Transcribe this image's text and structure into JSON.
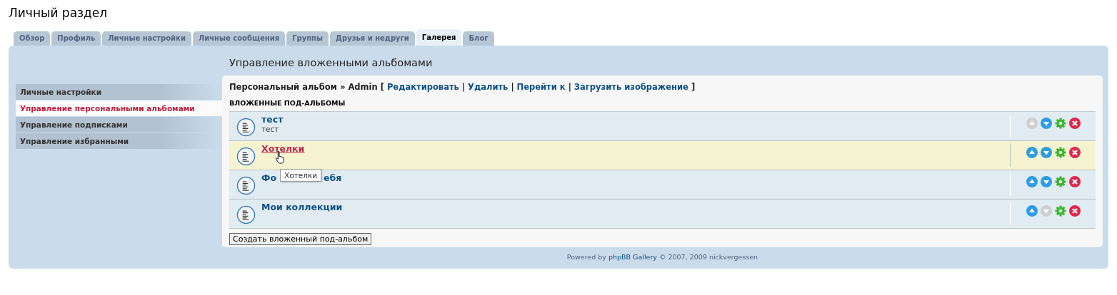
{
  "page_title": "Личный раздел",
  "tabs": [
    {
      "label": "Обзор",
      "selected": false
    },
    {
      "label": "Профиль",
      "selected": false
    },
    {
      "label": "Личные настройки",
      "selected": false
    },
    {
      "label": "Личные сообщения",
      "selected": false
    },
    {
      "label": "Группы",
      "selected": false
    },
    {
      "label": "Друзья и недруги",
      "selected": false
    },
    {
      "label": "Галерея",
      "selected": true
    },
    {
      "label": "Блог",
      "selected": false
    }
  ],
  "heading": "Управление вложенными альбомами",
  "sidebar": {
    "items": [
      {
        "label": "Личные настройки",
        "selected": false
      },
      {
        "label": "Управление персональными альбомами",
        "selected": true
      },
      {
        "label": "Управление подписками",
        "selected": false
      },
      {
        "label": "Управление избранными",
        "selected": false
      }
    ]
  },
  "breadcrumb": {
    "album": "Персональный альбом » Admin",
    "open": "[",
    "links": [
      "Редактировать",
      "Удалить",
      "Перейти к",
      "Загрузить изображение"
    ],
    "separators": [
      "|",
      "|",
      "|"
    ],
    "close": "]"
  },
  "section_title": "ВЛОЖЕННЫЕ ПОД-АЛЬБОМЫ",
  "albums": [
    {
      "title_parts": [
        "тест"
      ],
      "description": "тест",
      "highlighted": false,
      "up_enabled": false,
      "down_enabled": true
    },
    {
      "title_parts": [
        "Хотелки"
      ],
      "highlighted": true,
      "up_enabled": true,
      "down_enabled": true,
      "tooltip": "Хотелки"
    },
    {
      "title_parts": [
        "Фо",
        "ебя"
      ],
      "highlighted": false,
      "up_enabled": true,
      "down_enabled": true
    },
    {
      "title_parts": [
        "Мои коллекции"
      ],
      "highlighted": false,
      "up_enabled": true,
      "down_enabled": false
    }
  ],
  "create_button": "Создать вложенный под-альбом",
  "footer": {
    "prefix": "Powered by ",
    "link": "phpBB Gallery",
    "suffix": " © 2007, 2009 nickvergessen"
  }
}
